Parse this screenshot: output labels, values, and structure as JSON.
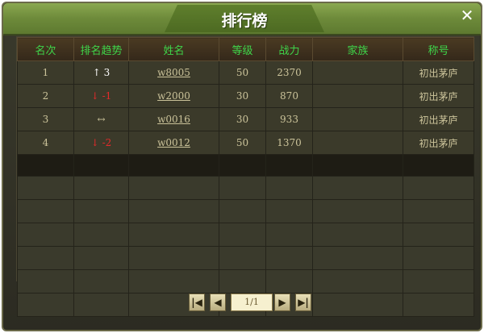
{
  "window": {
    "title": "排行榜",
    "close_glyph": "✕"
  },
  "table": {
    "headers": [
      "名次",
      "排名趋势",
      "姓名",
      "等级",
      "战力",
      "家族",
      "称号"
    ],
    "rows": [
      {
        "rank": "1",
        "trend_arrow": "↑",
        "trend_value": "3",
        "trend": "up",
        "name": "w8005",
        "level": "50",
        "power": "2370",
        "family": "",
        "title": "初出茅庐"
      },
      {
        "rank": "2",
        "trend_arrow": "↓",
        "trend_value": "-1",
        "trend": "down",
        "name": "w2000",
        "level": "30",
        "power": "870",
        "family": "",
        "title": "初出茅庐"
      },
      {
        "rank": "3",
        "trend_arrow": "↔",
        "trend_value": "",
        "trend": "flat",
        "name": "w0016",
        "level": "30",
        "power": "933",
        "family": "",
        "title": "初出茅庐"
      },
      {
        "rank": "4",
        "trend_arrow": "↓",
        "trend_value": "-2",
        "trend": "down",
        "name": "w0012",
        "level": "50",
        "power": "1370",
        "family": "",
        "title": "初出茅庐"
      }
    ]
  },
  "pager": {
    "first_glyph": "|◀",
    "prev_glyph": "◀",
    "page_label": "1/1",
    "next_glyph": "▶",
    "last_glyph": "▶|"
  },
  "colors": {
    "header_text": "#3fd54a",
    "down_trend": "#e42a2a",
    "up_trend": "#ffffff",
    "titlebar": "#6d8a3a"
  }
}
